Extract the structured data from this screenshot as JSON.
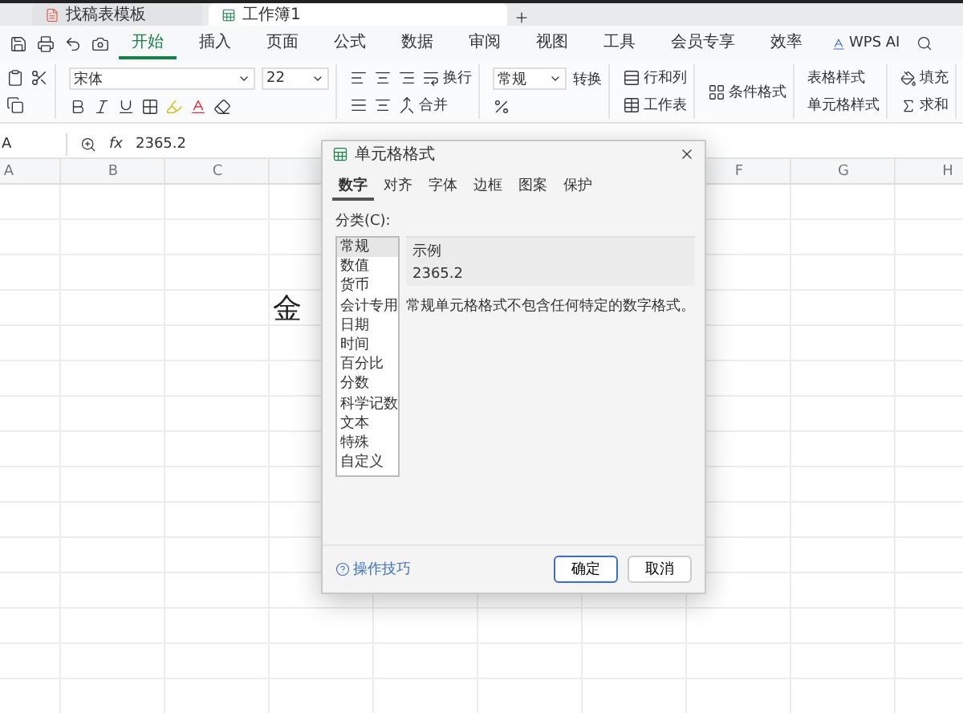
{
  "doc_tabs": [
    {
      "title": "找稿表模板",
      "selected": false,
      "kind": "pdf"
    },
    {
      "title": "工作簿1",
      "selected": true,
      "kind": "sheet"
    }
  ],
  "menu_tabs": [
    {
      "label": "开始",
      "selected": true
    },
    {
      "label": "插入",
      "selected": false
    },
    {
      "label": "页面",
      "selected": false
    },
    {
      "label": "公式",
      "selected": false
    },
    {
      "label": "数据",
      "selected": false
    },
    {
      "label": "审阅",
      "selected": false
    },
    {
      "label": "视图",
      "selected": false
    },
    {
      "label": "工具",
      "selected": false
    },
    {
      "label": "会员专享",
      "selected": false
    },
    {
      "label": "效率",
      "selected": false
    }
  ],
  "ai_button": "WPS AI",
  "ribbon": {
    "font_name": "宋体",
    "font_size": "22",
    "wrap": "换行",
    "merge": "合并",
    "number_format": "常规",
    "convert": "转换",
    "rows_cols": "行和列",
    "worksheet": "工作表",
    "conditional_format": "条件格式",
    "table_style": "表格样式",
    "cell_style": "单元格样式",
    "fill": "填充",
    "sum": "求和"
  },
  "formula_bar": {
    "name_box": "A",
    "fx_label": "fx",
    "formula": "2365.2"
  },
  "grid": {
    "columns": [
      "A",
      "B",
      "C",
      "F",
      "G",
      "H"
    ],
    "cell_text": "金"
  },
  "dialog": {
    "title": "单元格格式",
    "tabs": [
      {
        "label": "数字",
        "selected": true
      },
      {
        "label": "对齐",
        "selected": false
      },
      {
        "label": "字体",
        "selected": false
      },
      {
        "label": "边框",
        "selected": false
      },
      {
        "label": "图案",
        "selected": false
      },
      {
        "label": "保护",
        "selected": false
      }
    ],
    "category_label": "分类(C):",
    "categories": [
      {
        "label": "常规",
        "selected": true
      },
      {
        "label": "数值",
        "selected": false
      },
      {
        "label": "货币",
        "selected": false
      },
      {
        "label": "会计专用",
        "selected": false
      },
      {
        "label": "日期",
        "selected": false
      },
      {
        "label": "时间",
        "selected": false
      },
      {
        "label": "百分比",
        "selected": false
      },
      {
        "label": "分数",
        "selected": false
      },
      {
        "label": "科学记数",
        "selected": false
      },
      {
        "label": "文本",
        "selected": false
      },
      {
        "label": "特殊",
        "selected": false
      },
      {
        "label": "自定义",
        "selected": false
      }
    ],
    "sample_label": "示例",
    "sample_value": "2365.2",
    "description": "常规单元格格式不包含任何特定的数字格式。",
    "help_link": "操作技巧",
    "buttons": [
      {
        "label": "确定",
        "kind": "primary"
      },
      {
        "label": "取消",
        "kind": "secondary"
      }
    ]
  }
}
